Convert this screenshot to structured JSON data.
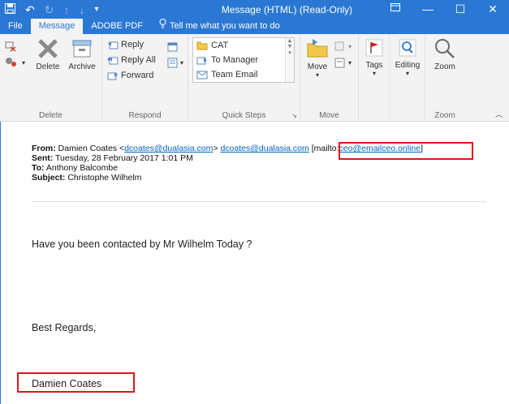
{
  "window": {
    "title": "Message (HTML) (Read-Only)"
  },
  "tabs": [
    {
      "label": "File"
    },
    {
      "label": "Message"
    },
    {
      "label": "ADOBE PDF"
    },
    {
      "label": "Tell me what you want to do"
    }
  ],
  "ribbon": {
    "delete_group": {
      "label": "Delete",
      "delete": "Delete",
      "archive": "Archive"
    },
    "respond_group": {
      "label": "Respond",
      "reply": "Reply",
      "reply_all": "Reply All",
      "forward": "Forward"
    },
    "quick_steps": {
      "label": "Quick Steps",
      "items": [
        "CAT",
        "To Manager",
        "Team Email"
      ]
    },
    "move_group": {
      "label": "Move",
      "move": "Move"
    },
    "tags": "Tags",
    "editing": "Editing",
    "zoom_group": {
      "label": "Zoom",
      "zoom": "Zoom"
    }
  },
  "message": {
    "from_label": "From:",
    "from_name": "Damien Coates <",
    "from_email": "dcoates@dualasia.com",
    "from_close": ">",
    "from_email2": "dcoates@dualasia.com",
    "mailto_open": "[mailto:",
    "mailto_email": "ceo@emailceo.online",
    "mailto_close": "]",
    "sent_label": "Sent:",
    "sent_value": "Tuesday, 28 February 2017 1:01 PM",
    "to_label": "To:",
    "to_value": "Anthony Balcombe",
    "subject_label": "Subject:",
    "subject_value": "Christophe Wilhelm",
    "body_line": "Have you been contacted by Mr Wilhelm Today ?",
    "closing": "Best Regards,",
    "signature": "Damien Coates"
  },
  "colors": {
    "accent": "#2b78d4",
    "highlight_box": "#e0151a",
    "link": "#0563c1"
  }
}
